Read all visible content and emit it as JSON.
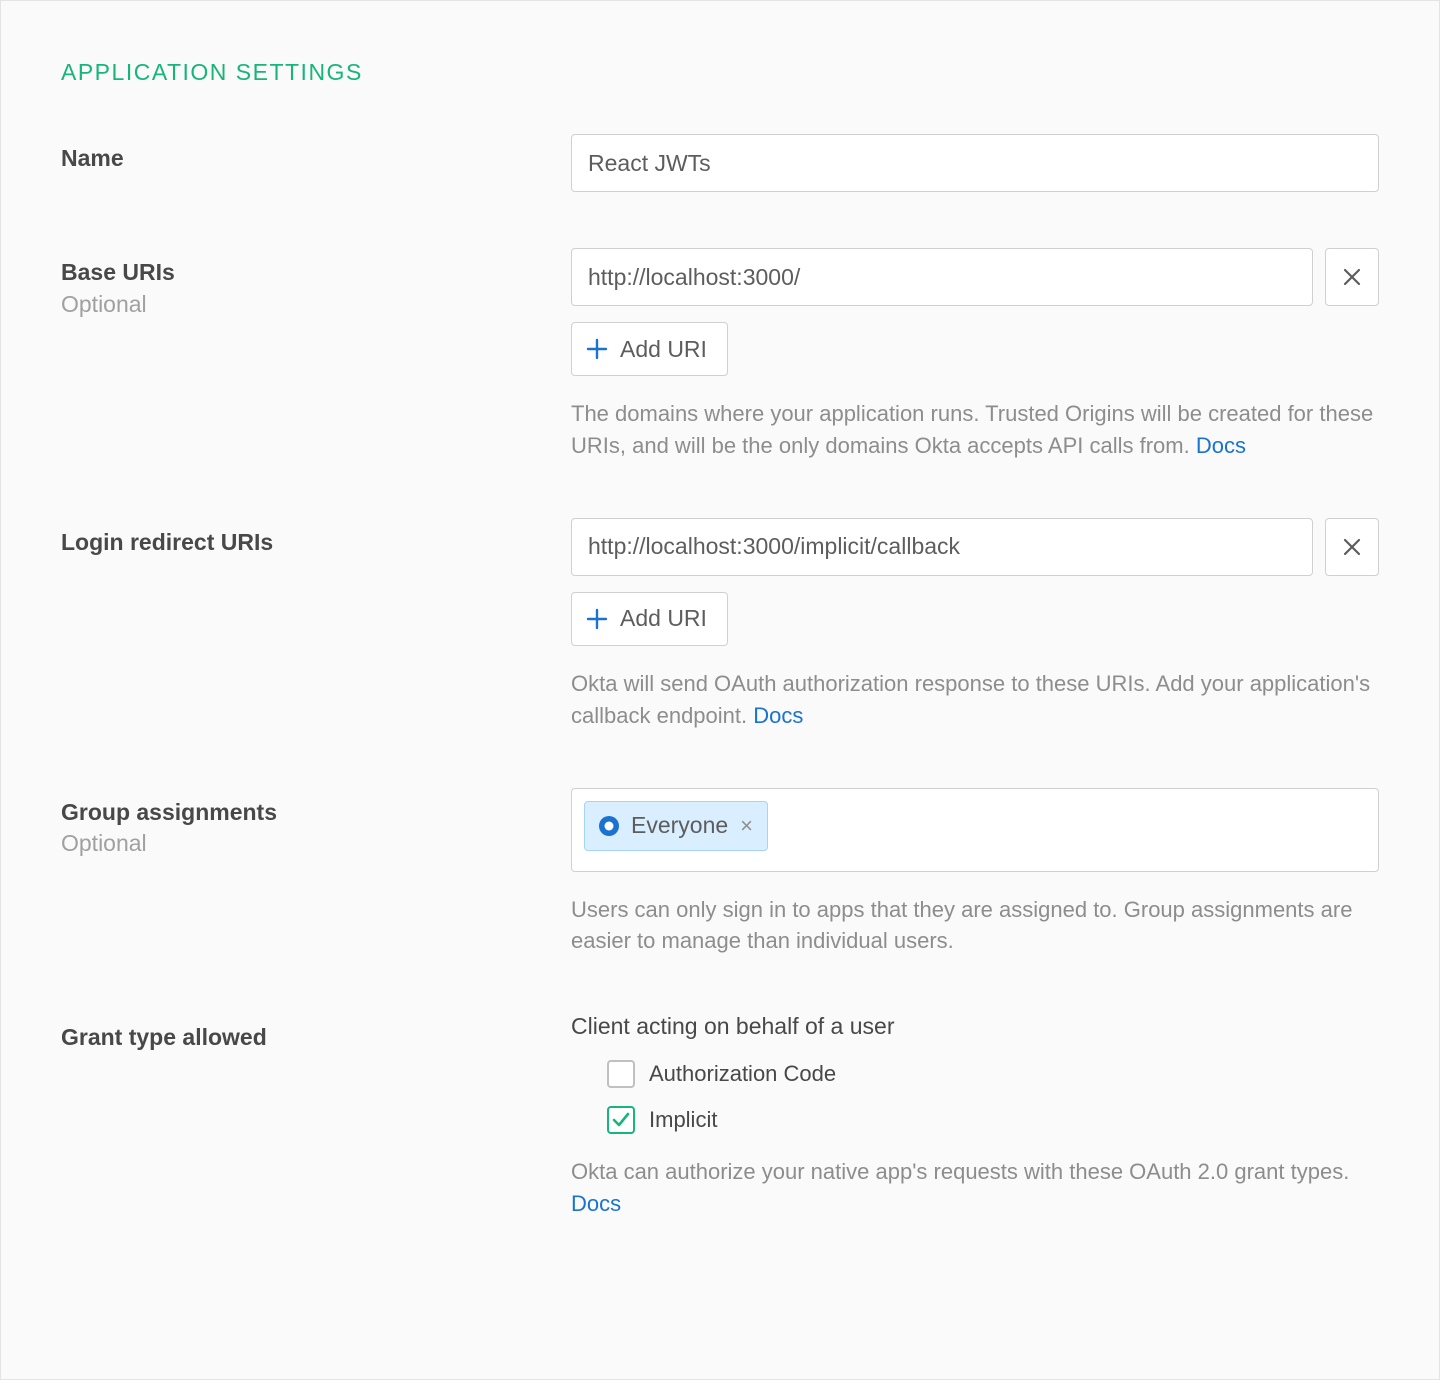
{
  "section_title": "APPLICATION SETTINGS",
  "name": {
    "label": "Name",
    "value": "React JWTs"
  },
  "base_uris": {
    "label": "Base URIs",
    "sublabel": "Optional",
    "value": "http://localhost:3000/",
    "add_button": "Add URI",
    "help": "The domains where your application runs. Trusted Origins will be created for these URIs, and will be the only domains Okta accepts API calls from. ",
    "docs_label": "Docs"
  },
  "login_redirect_uris": {
    "label": "Login redirect URIs",
    "value": "http://localhost:3000/implicit/callback",
    "add_button": "Add URI",
    "help": "Okta will send OAuth authorization response to these URIs. Add your application's callback endpoint. ",
    "docs_label": "Docs"
  },
  "group_assignments": {
    "label": "Group assignments",
    "sublabel": "Optional",
    "chip_label": "Everyone",
    "help": "Users can only sign in to apps that they are assigned to. Group assignments are easier to manage than individual users."
  },
  "grant_type": {
    "label": "Grant type allowed",
    "subtitle": "Client acting on behalf of a user",
    "options": {
      "authorization_code": {
        "label": "Authorization Code",
        "checked": false
      },
      "implicit": {
        "label": "Implicit",
        "checked": true
      }
    },
    "help": "Okta can authorize your native app's requests with these OAuth 2.0 grant types. ",
    "docs_label": "Docs"
  },
  "colors": {
    "accent_green": "#17b57b",
    "link_blue": "#1a73cf",
    "chip_bg": "#d9eefe",
    "chip_border": "#a5d4f7"
  }
}
